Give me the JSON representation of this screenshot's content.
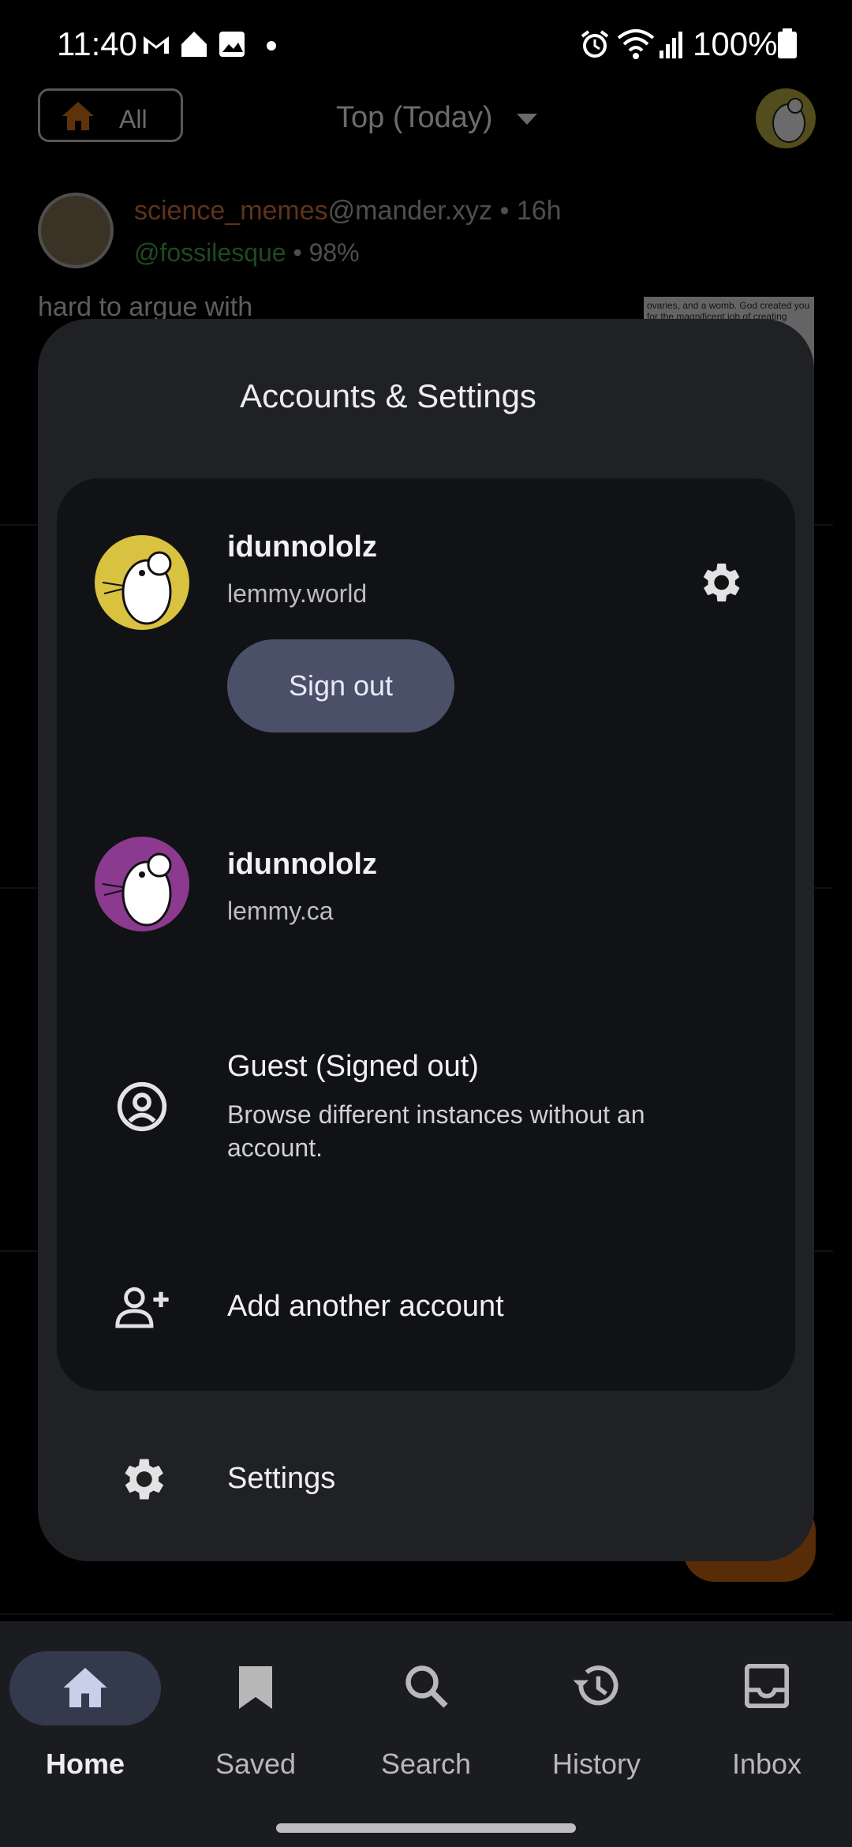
{
  "status_bar": {
    "time": "11:40",
    "battery": "100%"
  },
  "top_bar": {
    "filter_label": "All",
    "sort_label": "Top (Today)"
  },
  "post": {
    "community": "science_memes",
    "instance": "@mander.xyz",
    "age": " • 16h",
    "user": "@fossilesque",
    "score": " • 98%",
    "title": "hard to argue with",
    "thumb_text": "ovaries, and a womb. God created you for the magnificent job of creating"
  },
  "sheet": {
    "title": "Accounts & Settings",
    "accounts": [
      {
        "name": "idunnololz",
        "instance": "lemmy.world",
        "avatar_color": "#d9c23f"
      },
      {
        "name": "idunnololz",
        "instance": "lemmy.ca",
        "avatar_color": "#8b3a8f"
      }
    ],
    "sign_out_label": "Sign out",
    "guest": {
      "title": "Guest (Signed out)",
      "description_line1": "Browse different instances without an",
      "description_line2": "account."
    },
    "add_account_label": "Add another account",
    "settings_label": "Settings"
  },
  "bottom_nav": {
    "items": [
      {
        "label": "Home",
        "icon": "home-icon",
        "active": true
      },
      {
        "label": "Saved",
        "icon": "bookmark-icon"
      },
      {
        "label": "Search",
        "icon": "search-icon"
      },
      {
        "label": "History",
        "icon": "history-icon"
      },
      {
        "label": "Inbox",
        "icon": "inbox-icon"
      }
    ]
  },
  "colors": {
    "accent_orange": "#d06a10",
    "sign_out_bg": "#4a5068",
    "sheet_bg": "#202125",
    "card_bg": "#111215"
  }
}
